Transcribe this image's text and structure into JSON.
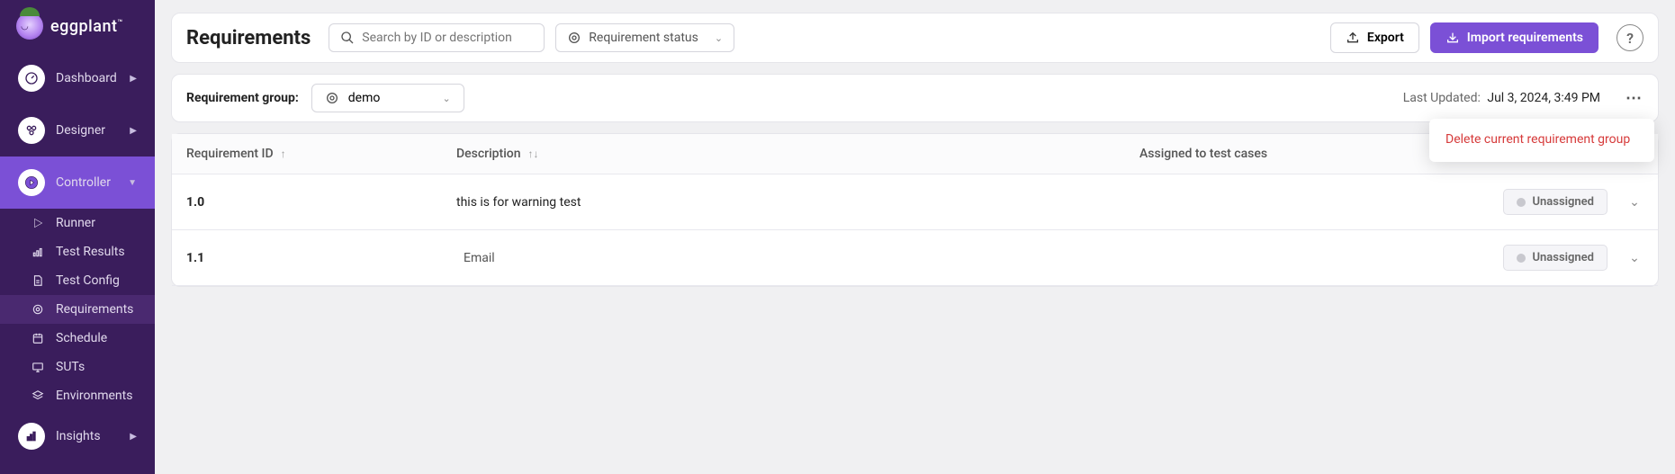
{
  "brand": "eggplant",
  "sidebar": {
    "major": [
      {
        "label": "Dashboard"
      },
      {
        "label": "Designer"
      },
      {
        "label": "Controller"
      }
    ],
    "subs": [
      {
        "label": "Runner"
      },
      {
        "label": "Test Results"
      },
      {
        "label": "Test Config"
      },
      {
        "label": "Requirements"
      },
      {
        "label": "Schedule"
      },
      {
        "label": "SUTs"
      },
      {
        "label": "Environments"
      }
    ],
    "insights": "Insights"
  },
  "header": {
    "title": "Requirements",
    "search_placeholder": "Search by ID or description",
    "status_label": "Requirement status",
    "export_label": "Export",
    "import_label": "Import requirements"
  },
  "group_bar": {
    "label": "Requirement group:",
    "selected": "demo",
    "last_updated_label": "Last Updated:",
    "last_updated_value": "Jul 3, 2024, 3:49 PM"
  },
  "table": {
    "columns": {
      "id": "Requirement ID",
      "desc": "Description",
      "assigned": "Assigned to test cases"
    },
    "rows": [
      {
        "id": "1.0",
        "desc": "this is for warning test",
        "status": "Unassigned"
      },
      {
        "id": "1.1",
        "desc": "Email",
        "status": "Unassigned"
      }
    ]
  },
  "menu": {
    "delete_group": "Delete current requirement group"
  }
}
